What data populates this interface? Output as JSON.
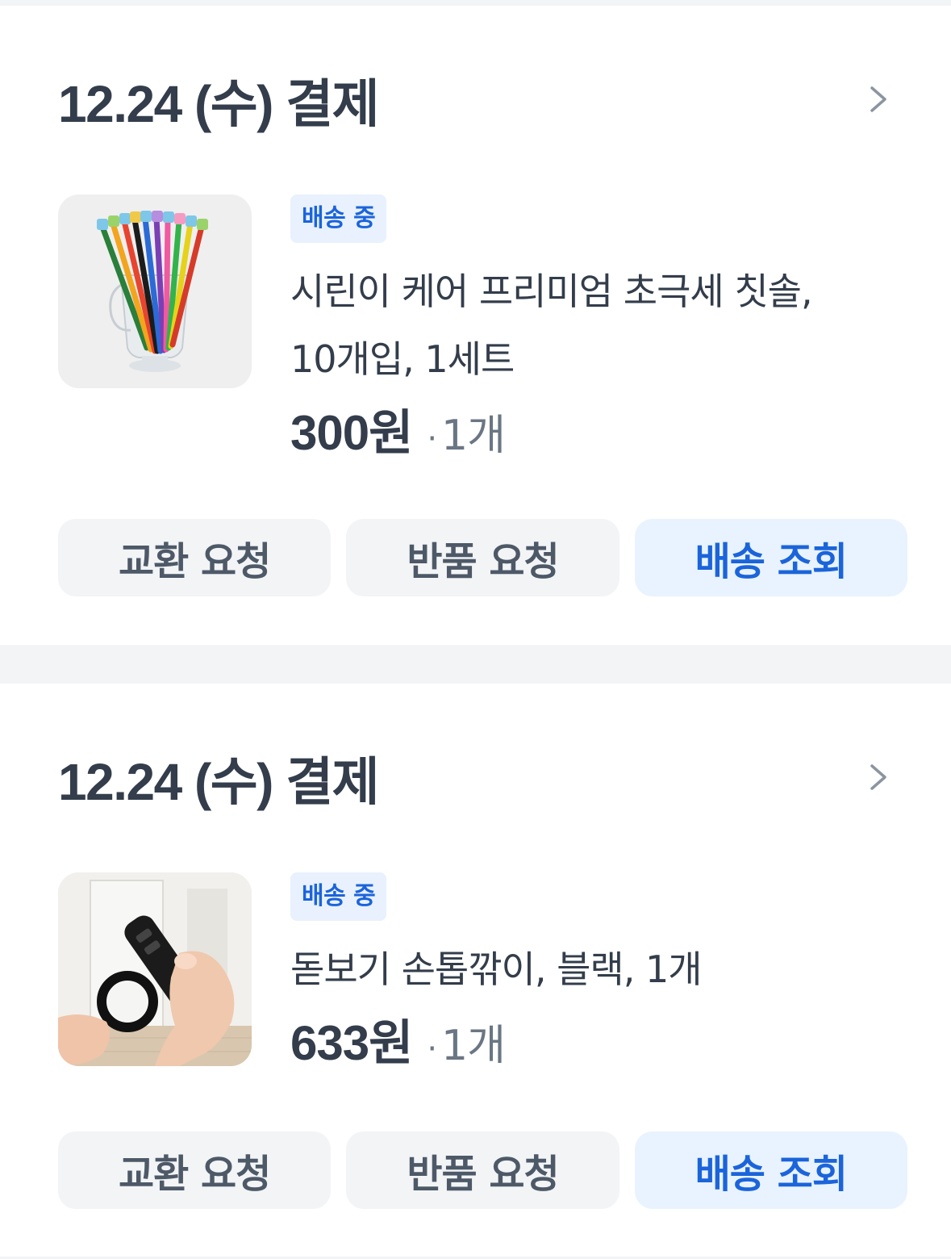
{
  "orders": [
    {
      "date_label": "12.24 (수) 결제",
      "status_badge": "배송 중",
      "product_name_line1": "시린이 케어 프리미엄 초극세 칫솔,",
      "product_name_line2": "10개입, 1세트",
      "price": "300원",
      "quantity": "1개",
      "thumbnail": "toothbrush-cup-image",
      "buttons": {
        "exchange": "교환 요청",
        "return": "반품 요청",
        "track": "배송 조회"
      }
    },
    {
      "date_label": "12.24 (수) 결제",
      "status_badge": "배송 중",
      "product_name_line1": "돋보기 손톱깎이, 블랙, 1개",
      "price": "633원",
      "quantity": "1개",
      "thumbnail": "nail-clipper-image",
      "buttons": {
        "exchange": "교환 요청",
        "return": "반품 요청",
        "track": "배송 조회"
      }
    }
  ],
  "icons": {
    "chevron": "chevron-right-icon"
  },
  "colors": {
    "badge_bg": "#e8f1fd",
    "badge_text": "#1b64da",
    "primary_button_bg": "#e8f3ff",
    "secondary_button_bg": "#f2f4f6",
    "page_bg": "#f2f4f6",
    "text_main": "#333d4b",
    "text_sub": "#6b7684"
  }
}
